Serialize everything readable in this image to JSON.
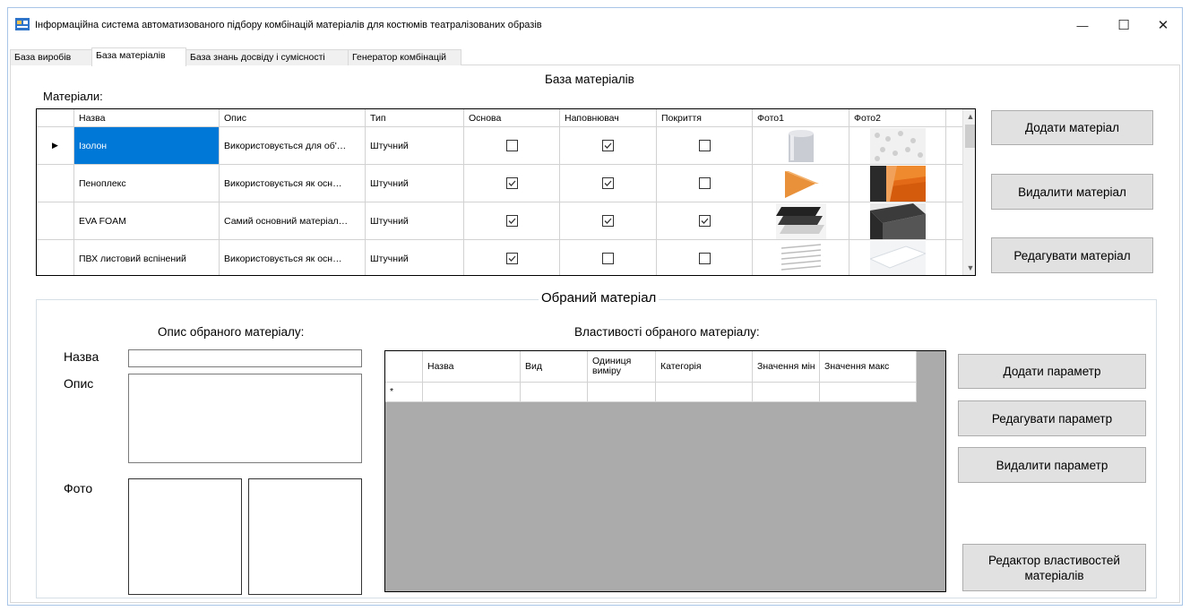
{
  "window": {
    "title": "Інформаційна система автоматизованого підбору комбінацій матеріалів для костюмів театралізованих образів",
    "min_glyph": "—",
    "max_glyph": "☐",
    "close_glyph": "✕"
  },
  "tabs": [
    {
      "label": "База виробів",
      "active": false
    },
    {
      "label": "База матеріалів",
      "active": true
    },
    {
      "label": "База знань досвіду і сумісності",
      "active": false
    },
    {
      "label": "Генератор комбінацій",
      "active": false
    }
  ],
  "page": {
    "heading": "База матеріалів",
    "materials_label": "Матеріали:"
  },
  "materials_grid": {
    "columns": [
      "Назва",
      "Опис",
      "Тип",
      "Основа",
      "Наповнювач",
      "Покриття",
      "Фото1",
      "Фото2"
    ],
    "rows": [
      {
        "name": "Ізолон",
        "description": "Використовується для об'…",
        "type": "Штучний",
        "osnova": false,
        "napovniuvach": true,
        "pokryttia": false,
        "selected": true,
        "photo1": "foam-roll",
        "photo2": "white-foam"
      },
      {
        "name": "Пеноплекс",
        "description": "Використовується як осн…",
        "type": "Штучний",
        "osnova": true,
        "napovniuvach": true,
        "pokryttia": false,
        "selected": false,
        "photo1": "orange-board",
        "photo2": "orange-stack"
      },
      {
        "name": "EVA FOAM",
        "description": "Самий основний матеріал…",
        "type": "Штучний",
        "osnova": true,
        "napovniuvach": true,
        "pokryttia": true,
        "selected": false,
        "photo1": "black-sheets",
        "photo2": "dark-foam"
      },
      {
        "name": "ПВХ листовий вспінений",
        "description": "Використовується як осн…",
        "type": "Штучний",
        "osnova": true,
        "napovniuvach": false,
        "pokryttia": false,
        "selected": false,
        "photo1": "white-sheets",
        "photo2": "white-board"
      }
    ]
  },
  "material_buttons": {
    "add": "Додати матеріал",
    "delete": "Видалити матеріал",
    "edit": "Редагувати матеріал"
  },
  "selected_material": {
    "group_title": "Обраний матеріал",
    "description_heading": "Опис обраного матеріалу:",
    "name_label": "Назва",
    "desc_label": "Опис",
    "photo_label": "Фото",
    "name_value": "",
    "desc_value": ""
  },
  "properties": {
    "heading": "Властивості обраного матеріалу:",
    "columns": [
      "Назва",
      "Вид",
      "Одиниця виміру",
      "Категорія",
      "Значення мін",
      "Значення макс"
    ],
    "new_row_marker": "*"
  },
  "param_buttons": {
    "add": "Додати параметр",
    "edit": "Редагувати параметр",
    "delete": "Видалити параметр",
    "editor": "Редактор властивостей матеріалів"
  },
  "colors": {
    "selection": "#0078d7",
    "grid_background": "#ababab",
    "button_face": "#e1e1e1"
  }
}
